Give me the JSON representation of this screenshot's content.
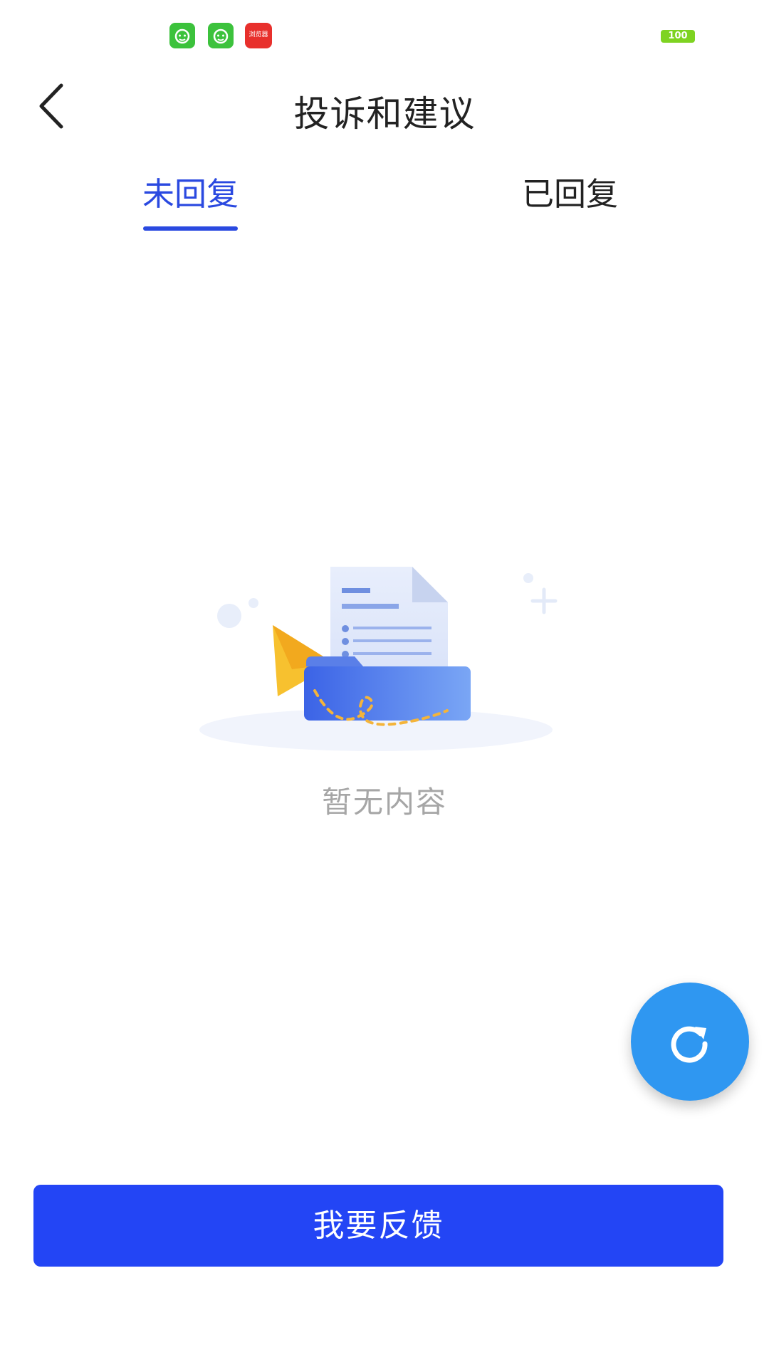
{
  "status_bar": {
    "notification_icons": [
      "cat-app-icon",
      "cat-app-icon",
      "news-app-icon"
    ],
    "news_app_label": "浏览器",
    "battery_level": "100"
  },
  "header": {
    "title": "投诉和建议",
    "back_icon": "chevron-left-icon"
  },
  "tabs": [
    {
      "label": "未回复",
      "active": true
    },
    {
      "label": "已回复",
      "active": false
    }
  ],
  "empty_state": {
    "illustration_icon": "empty-folder-document-icon",
    "message": "暂无内容"
  },
  "refresh_fab": {
    "icon": "refresh-icon"
  },
  "primary_action": {
    "label": "我要反馈"
  },
  "colors": {
    "accent": "#2a49e0",
    "button": "#2345f5",
    "fab": "#2f97f1",
    "muted_text": "#a6a6a6"
  }
}
